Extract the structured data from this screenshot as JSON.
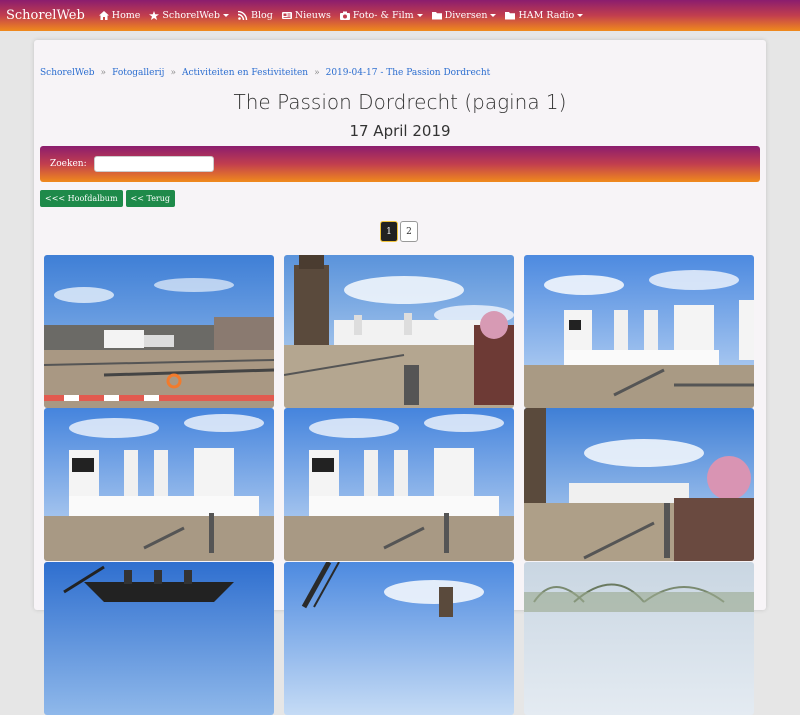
{
  "navbar": {
    "brand": "SchorelWeb",
    "items": [
      {
        "label": "Home",
        "icon": "home-icon",
        "dropdown": false
      },
      {
        "label": "SchorelWeb",
        "icon": "star-icon",
        "dropdown": true
      },
      {
        "label": "Blog",
        "icon": "rss-icon",
        "dropdown": false
      },
      {
        "label": "Nieuws",
        "icon": "newspaper-icon",
        "dropdown": false
      },
      {
        "label": "Foto- & Film",
        "icon": "camera-icon",
        "dropdown": true
      },
      {
        "label": "Diversen",
        "icon": "folder-icon",
        "dropdown": true
      },
      {
        "label": "HAM Radio",
        "icon": "folder-icon",
        "dropdown": true
      }
    ]
  },
  "breadcrumb": [
    "SchorelWeb",
    "Fotogallerij",
    "Activiteiten en Festiviteiten",
    "2019-04-17 - The Passion Dordrecht"
  ],
  "breadcrumb_separator": "»",
  "page": {
    "title": "The Passion Dordrecht (pagina 1)",
    "subtitle": "17 April 2019"
  },
  "search": {
    "label": "Zoeken:",
    "value": "",
    "placeholder": ""
  },
  "buttons": {
    "main_album": "<<< Hoofdalbum",
    "back": "<< Terug"
  },
  "pagination": {
    "pages": [
      "1",
      "2"
    ],
    "current": "1"
  },
  "colors": {
    "gradient_top": "#8b1d6e",
    "gradient_bottom": "#f08a1c",
    "button_green": "#1e8a4a",
    "link_blue": "#2c6ed0"
  },
  "photos": [
    {
      "alt": "photo-1"
    },
    {
      "alt": "photo-2"
    },
    {
      "alt": "photo-3"
    },
    {
      "alt": "photo-4"
    },
    {
      "alt": "photo-5"
    },
    {
      "alt": "photo-6"
    },
    {
      "alt": "photo-7"
    },
    {
      "alt": "photo-8"
    },
    {
      "alt": "photo-9"
    }
  ]
}
